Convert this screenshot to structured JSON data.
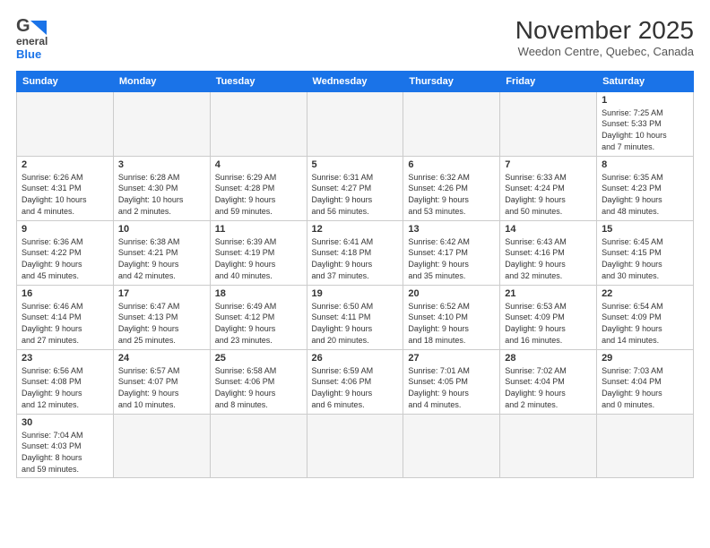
{
  "logo": {
    "line1": "General",
    "line2": "Blue"
  },
  "header": {
    "title": "November 2025",
    "subtitle": "Weedon Centre, Quebec, Canada"
  },
  "weekdays": [
    "Sunday",
    "Monday",
    "Tuesday",
    "Wednesday",
    "Thursday",
    "Friday",
    "Saturday"
  ],
  "weeks": [
    [
      {
        "day": "",
        "info": ""
      },
      {
        "day": "",
        "info": ""
      },
      {
        "day": "",
        "info": ""
      },
      {
        "day": "",
        "info": ""
      },
      {
        "day": "",
        "info": ""
      },
      {
        "day": "",
        "info": ""
      },
      {
        "day": "1",
        "info": "Sunrise: 7:25 AM\nSunset: 5:33 PM\nDaylight: 10 hours\nand 7 minutes."
      }
    ],
    [
      {
        "day": "2",
        "info": "Sunrise: 6:26 AM\nSunset: 4:31 PM\nDaylight: 10 hours\nand 4 minutes."
      },
      {
        "day": "3",
        "info": "Sunrise: 6:28 AM\nSunset: 4:30 PM\nDaylight: 10 hours\nand 2 minutes."
      },
      {
        "day": "4",
        "info": "Sunrise: 6:29 AM\nSunset: 4:28 PM\nDaylight: 9 hours\nand 59 minutes."
      },
      {
        "day": "5",
        "info": "Sunrise: 6:31 AM\nSunset: 4:27 PM\nDaylight: 9 hours\nand 56 minutes."
      },
      {
        "day": "6",
        "info": "Sunrise: 6:32 AM\nSunset: 4:26 PM\nDaylight: 9 hours\nand 53 minutes."
      },
      {
        "day": "7",
        "info": "Sunrise: 6:33 AM\nSunset: 4:24 PM\nDaylight: 9 hours\nand 50 minutes."
      },
      {
        "day": "8",
        "info": "Sunrise: 6:35 AM\nSunset: 4:23 PM\nDaylight: 9 hours\nand 48 minutes."
      }
    ],
    [
      {
        "day": "9",
        "info": "Sunrise: 6:36 AM\nSunset: 4:22 PM\nDaylight: 9 hours\nand 45 minutes."
      },
      {
        "day": "10",
        "info": "Sunrise: 6:38 AM\nSunset: 4:21 PM\nDaylight: 9 hours\nand 42 minutes."
      },
      {
        "day": "11",
        "info": "Sunrise: 6:39 AM\nSunset: 4:19 PM\nDaylight: 9 hours\nand 40 minutes."
      },
      {
        "day": "12",
        "info": "Sunrise: 6:41 AM\nSunset: 4:18 PM\nDaylight: 9 hours\nand 37 minutes."
      },
      {
        "day": "13",
        "info": "Sunrise: 6:42 AM\nSunset: 4:17 PM\nDaylight: 9 hours\nand 35 minutes."
      },
      {
        "day": "14",
        "info": "Sunrise: 6:43 AM\nSunset: 4:16 PM\nDaylight: 9 hours\nand 32 minutes."
      },
      {
        "day": "15",
        "info": "Sunrise: 6:45 AM\nSunset: 4:15 PM\nDaylight: 9 hours\nand 30 minutes."
      }
    ],
    [
      {
        "day": "16",
        "info": "Sunrise: 6:46 AM\nSunset: 4:14 PM\nDaylight: 9 hours\nand 27 minutes."
      },
      {
        "day": "17",
        "info": "Sunrise: 6:47 AM\nSunset: 4:13 PM\nDaylight: 9 hours\nand 25 minutes."
      },
      {
        "day": "18",
        "info": "Sunrise: 6:49 AM\nSunset: 4:12 PM\nDaylight: 9 hours\nand 23 minutes."
      },
      {
        "day": "19",
        "info": "Sunrise: 6:50 AM\nSunset: 4:11 PM\nDaylight: 9 hours\nand 20 minutes."
      },
      {
        "day": "20",
        "info": "Sunrise: 6:52 AM\nSunset: 4:10 PM\nDaylight: 9 hours\nand 18 minutes."
      },
      {
        "day": "21",
        "info": "Sunrise: 6:53 AM\nSunset: 4:09 PM\nDaylight: 9 hours\nand 16 minutes."
      },
      {
        "day": "22",
        "info": "Sunrise: 6:54 AM\nSunset: 4:09 PM\nDaylight: 9 hours\nand 14 minutes."
      }
    ],
    [
      {
        "day": "23",
        "info": "Sunrise: 6:56 AM\nSunset: 4:08 PM\nDaylight: 9 hours\nand 12 minutes."
      },
      {
        "day": "24",
        "info": "Sunrise: 6:57 AM\nSunset: 4:07 PM\nDaylight: 9 hours\nand 10 minutes."
      },
      {
        "day": "25",
        "info": "Sunrise: 6:58 AM\nSunset: 4:06 PM\nDaylight: 9 hours\nand 8 minutes."
      },
      {
        "day": "26",
        "info": "Sunrise: 6:59 AM\nSunset: 4:06 PM\nDaylight: 9 hours\nand 6 minutes."
      },
      {
        "day": "27",
        "info": "Sunrise: 7:01 AM\nSunset: 4:05 PM\nDaylight: 9 hours\nand 4 minutes."
      },
      {
        "day": "28",
        "info": "Sunrise: 7:02 AM\nSunset: 4:04 PM\nDaylight: 9 hours\nand 2 minutes."
      },
      {
        "day": "29",
        "info": "Sunrise: 7:03 AM\nSunset: 4:04 PM\nDaylight: 9 hours\nand 0 minutes."
      }
    ],
    [
      {
        "day": "30",
        "info": "Sunrise: 7:04 AM\nSunset: 4:03 PM\nDaylight: 8 hours\nand 59 minutes."
      },
      {
        "day": "",
        "info": ""
      },
      {
        "day": "",
        "info": ""
      },
      {
        "day": "",
        "info": ""
      },
      {
        "day": "",
        "info": ""
      },
      {
        "day": "",
        "info": ""
      },
      {
        "day": "",
        "info": ""
      }
    ]
  ]
}
